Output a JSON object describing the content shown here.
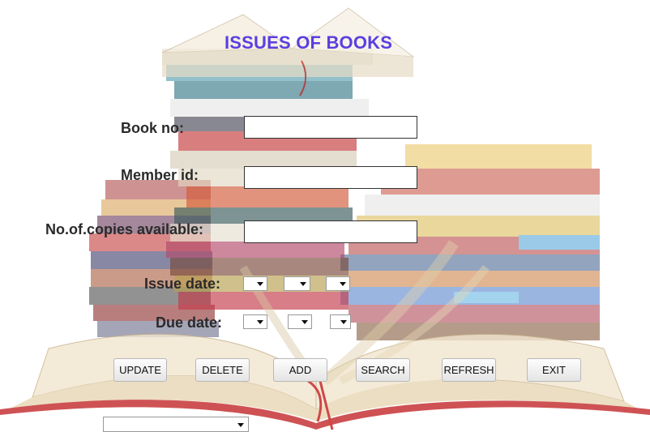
{
  "title": "ISSUES OF BOOKS",
  "fields": {
    "book_no": {
      "label": "Book no:",
      "value": ""
    },
    "member_id": {
      "label": "Member id:",
      "value": ""
    },
    "copies_available": {
      "label": "No.of.copies available:",
      "value": ""
    }
  },
  "issue_date": {
    "label": "Issue date:",
    "day": "",
    "month": "",
    "year": ""
  },
  "due_date": {
    "label": "Due date:",
    "day": "",
    "month": "",
    "year": ""
  },
  "buttons": {
    "update": "UPDATE",
    "delete": "DELETE",
    "add": "ADD",
    "search": "SEARCH",
    "refresh": "REFRESH",
    "exit": "EXIT"
  },
  "bottom_select": {
    "value": ""
  },
  "background": {
    "image": "book-stack-image"
  },
  "colors": {
    "title": "#5a3fe0",
    "label": "#2a2a2a"
  }
}
